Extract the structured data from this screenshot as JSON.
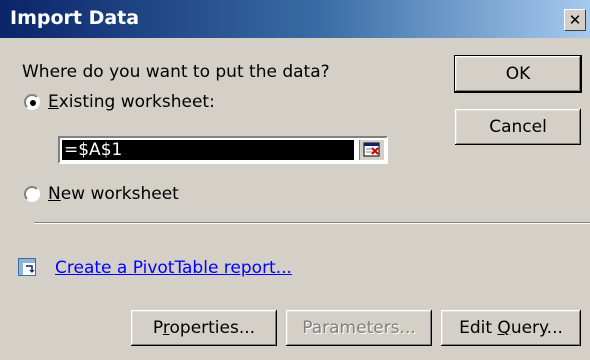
{
  "window": {
    "title": "Import Data",
    "close_glyph": "✕"
  },
  "prompt": {
    "text": "Where do you want to put the data?"
  },
  "options": {
    "existing": {
      "label_prefix": "",
      "label_accel": "E",
      "label_rest": "xisting worksheet:",
      "selected": true
    },
    "new": {
      "label_prefix": "",
      "label_accel": "N",
      "label_rest": "ew worksheet",
      "selected": false
    }
  },
  "range": {
    "value": "=$A$1",
    "collapse_icon": "collapse-dialog-icon"
  },
  "pivot": {
    "icon": "pivottable-icon",
    "link_text": "Create a PivotTable report..."
  },
  "buttons": {
    "ok": "OK",
    "cancel": "Cancel",
    "properties": {
      "before": "P",
      "accel": "r",
      "after": "operties..."
    },
    "parameters": "Parameters...",
    "edit_query": {
      "before": "Edit ",
      "accel": "Q",
      "after": "uery..."
    }
  },
  "colors": {
    "face": "#d4d0c8",
    "title_start": "#0a246a",
    "title_end": "#a6caf0",
    "link": "#0000ff"
  }
}
